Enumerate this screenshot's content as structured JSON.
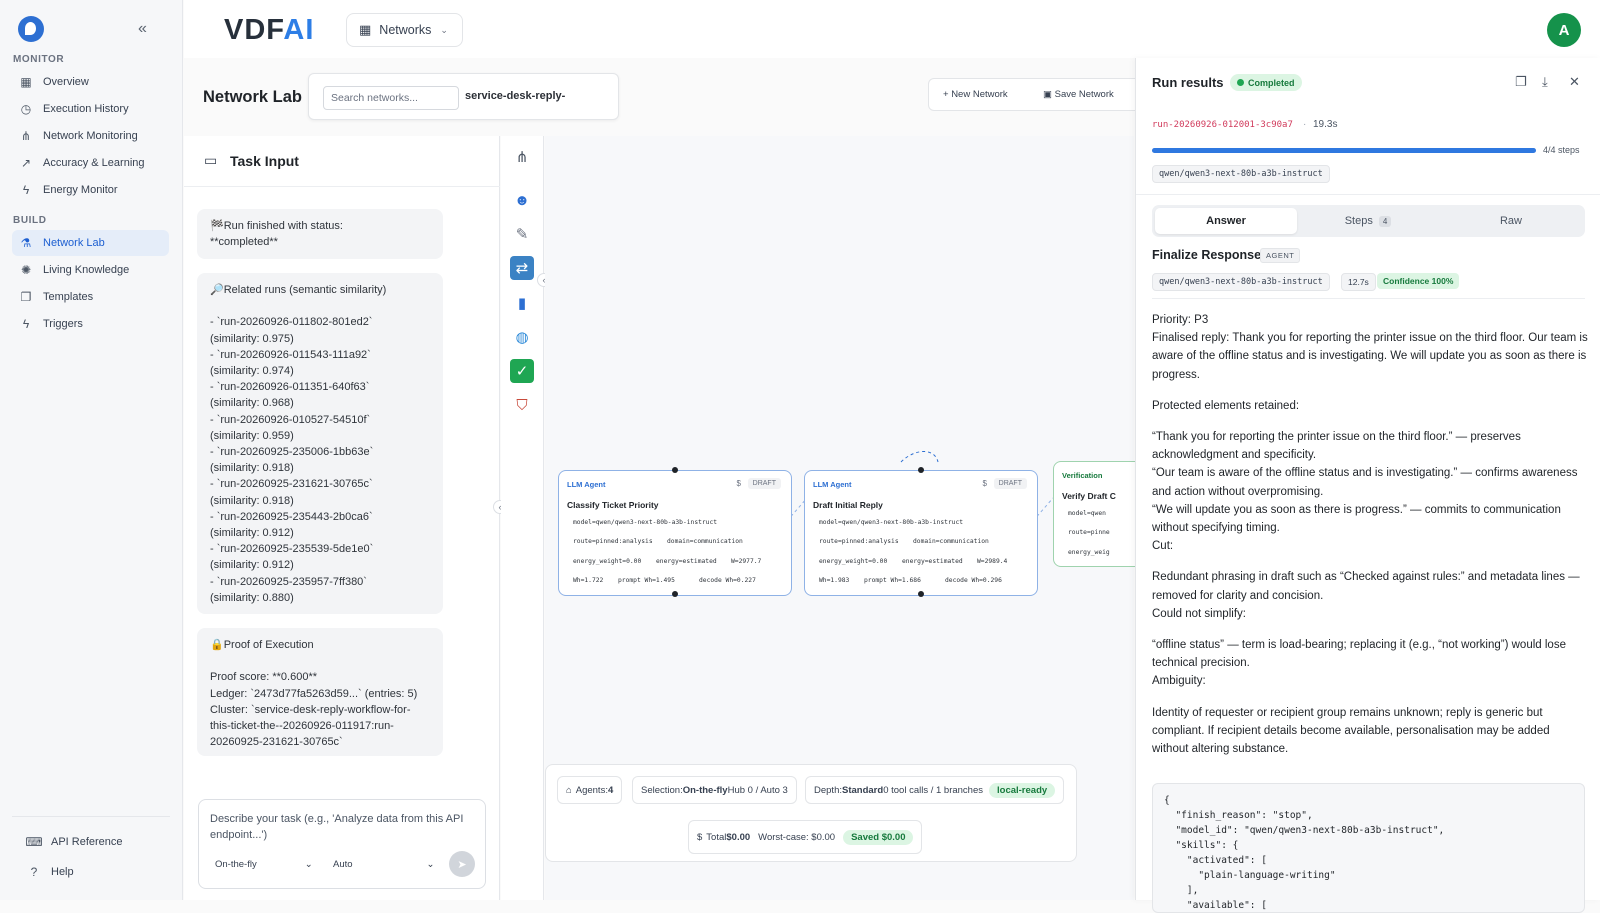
{
  "brand": {
    "name_main": "VDF",
    "name_ai": "AI"
  },
  "top": {
    "networks_label": "Networks",
    "avatar_letter": "A"
  },
  "sidebar": {
    "monitor_label": "MONITOR",
    "build_label": "BUILD",
    "monitor_items": [
      {
        "label": "Overview",
        "icon": "grid-icon"
      },
      {
        "label": "Execution History",
        "icon": "history-icon"
      },
      {
        "label": "Network Monitoring",
        "icon": "network-icon"
      },
      {
        "label": "Accuracy & Learning",
        "icon": "trend-icon"
      },
      {
        "label": "Energy Monitor",
        "icon": "bolt-icon"
      }
    ],
    "build_items": [
      {
        "label": "Network Lab",
        "icon": "flask-icon",
        "active": true
      },
      {
        "label": "Living Knowledge",
        "icon": "brain-icon"
      },
      {
        "label": "Templates",
        "icon": "copy-icon"
      },
      {
        "label": "Triggers",
        "icon": "bolt-icon"
      }
    ],
    "footer_items": [
      {
        "label": "API Reference",
        "icon": "code-icon"
      },
      {
        "label": "Help",
        "icon": "help-icon"
      }
    ]
  },
  "lab": {
    "title": "Network Lab",
    "search_placeholder": "Search networks...",
    "current_network": "service-desk-reply-",
    "new_network": "New Network",
    "save_network": "Save Network"
  },
  "task": {
    "title": "Task Input",
    "messages": [
      "🏁Run finished with status:\n**completed**",
      "🔎Related runs (semantic similarity)\n\n- `run-20260926-011802-801ed2`\n(similarity: 0.975)\n- `run-20260926-011543-111a92`\n(similarity: 0.974)\n- `run-20260926-011351-640f63`\n(similarity: 0.968)\n- `run-20260926-010527-54510f`\n(similarity: 0.959)\n- `run-20260925-235006-1bb63e`\n(similarity: 0.918)\n- `run-20260925-231621-30765c`\n(similarity: 0.918)\n- `run-20260925-235443-2b0ca6`\n(similarity: 0.912)\n- `run-20260925-235539-5de1e0`\n(similarity: 0.912)\n- `run-20260925-235957-7ff380`\n(similarity: 0.880)",
      "🔒Proof of Execution\n\nProof score: **0.600**\nLedger: `2473d77fa5263d59...` (entries: 5)\nCluster: `service-desk-reply-workflow-for-this-ticket-the--20260926-011917:run-20260925-231621-30765c`"
    ],
    "placeholder": "Describe your task (e.g., 'Analyze data from this API endpoint...')",
    "mode": "On-the-fly",
    "model": "Auto"
  },
  "tools": [
    "network-icon",
    "robot-icon",
    "wrench-icon",
    "shuffle-icon",
    "chart-icon",
    "globe-icon",
    "check-icon",
    "shield-icon"
  ],
  "canvas": {
    "nodes": [
      {
        "type": "LLM Agent",
        "badge": "DRAFT",
        "title": "Classify Ticket Priority",
        "model": "model=qwen/qwen3-next-80b-a3b-instruct",
        "route": "route=pinned:analysis",
        "domain": "domain=communication",
        "energy": "energy_weight=0.00",
        "estimated": "energy=estimated",
        "w": "W=2977.7",
        "wh": "Wh=1.722",
        "prompt": "prompt Wh=1.495",
        "decode": "decode Wh=0.227"
      },
      {
        "type": "LLM Agent",
        "badge": "DRAFT",
        "title": "Draft Initial Reply",
        "model": "model=qwen/qwen3-next-80b-a3b-instruct",
        "route": "route=pinned:analysis",
        "domain": "domain=communication",
        "energy": "energy_weight=0.00",
        "estimated": "energy=estimated",
        "w": "W=2989.4",
        "wh": "Wh=1.983",
        "prompt": "prompt Wh=1.686",
        "decode": "decode Wh=0.296"
      },
      {
        "type": "Verification",
        "badge": "",
        "title": "Verify Draft C",
        "model": "model=qwen",
        "route": "route=pinne",
        "domain": "",
        "energy": "energy_weig",
        "estimated": "",
        "w": "",
        "wh": "",
        "prompt": "",
        "decode": ""
      }
    ],
    "stats": {
      "agents_label": "Agents:",
      "agents_value": "4",
      "selection_label": "Selection:",
      "selection_value": "On-the-fly",
      "hub": "Hub 0 / Auto 3",
      "depth_label": "Depth:",
      "depth_value": "Standard",
      "calls": "0 tool calls / 1 branches",
      "local": "local-ready",
      "total_label": "Total",
      "total_value": "$0.00",
      "worst": "Worst-case: $0.00",
      "saved": "Saved $0.00"
    }
  },
  "results": {
    "title": "Run results",
    "status": "Completed",
    "run_id": "run-20260926-012001-3c90a7",
    "duration": "19.3s",
    "progress": 1.0,
    "steps_label": "4/4 steps",
    "model": "qwen/qwen3-next-80b-a3b-instruct",
    "tabs": [
      {
        "label": "Answer"
      },
      {
        "label": "Steps",
        "count": "4"
      },
      {
        "label": "Raw"
      }
    ],
    "step_name": "Finalize Response",
    "step_kind": "AGENT",
    "step_model": "qwen/qwen3-next-80b-a3b-instruct",
    "step_time": "12.7s",
    "confidence": "Confidence 100%",
    "answer": [
      [
        "Priority: P3",
        "Finalised reply: Thank you for reporting the printer issue on the third floor. Our team is aware of the offline status and is investigating. We will update you as soon as there is progress."
      ],
      [
        "Protected elements retained:"
      ],
      [
        "“Thank you for reporting the printer issue on the third floor.” — preserves acknowledgment and specificity.",
        "“Our team is aware of the offline status and is investigating.” — confirms awareness and action without overpromising.",
        "“We will update you as soon as there is progress.” — commits to communication without specifying timing.",
        "Cut:"
      ],
      [
        "Redundant phrasing in draft such as “Checked against rules:” and metadata lines — removed for clarity and concision.",
        "Could not simplify:"
      ],
      [
        "“offline status” — term is load-bearing; replacing it (e.g., “not working”) would lose technical precision.",
        "Ambiguity:"
      ],
      [
        "Identity of requester or recipient group remains unknown; reply is generic but compliant. If recipient details become available, personalisation may be added without altering substance."
      ]
    ],
    "raw_json": "{\n  \"finish_reason\": \"stop\",\n  \"model_id\": \"qwen/qwen3-next-80b-a3b-instruct\",\n  \"skills\": {\n    \"activated\": [\n      \"plain-language-writing\"\n    ],\n    \"available\": ["
  }
}
